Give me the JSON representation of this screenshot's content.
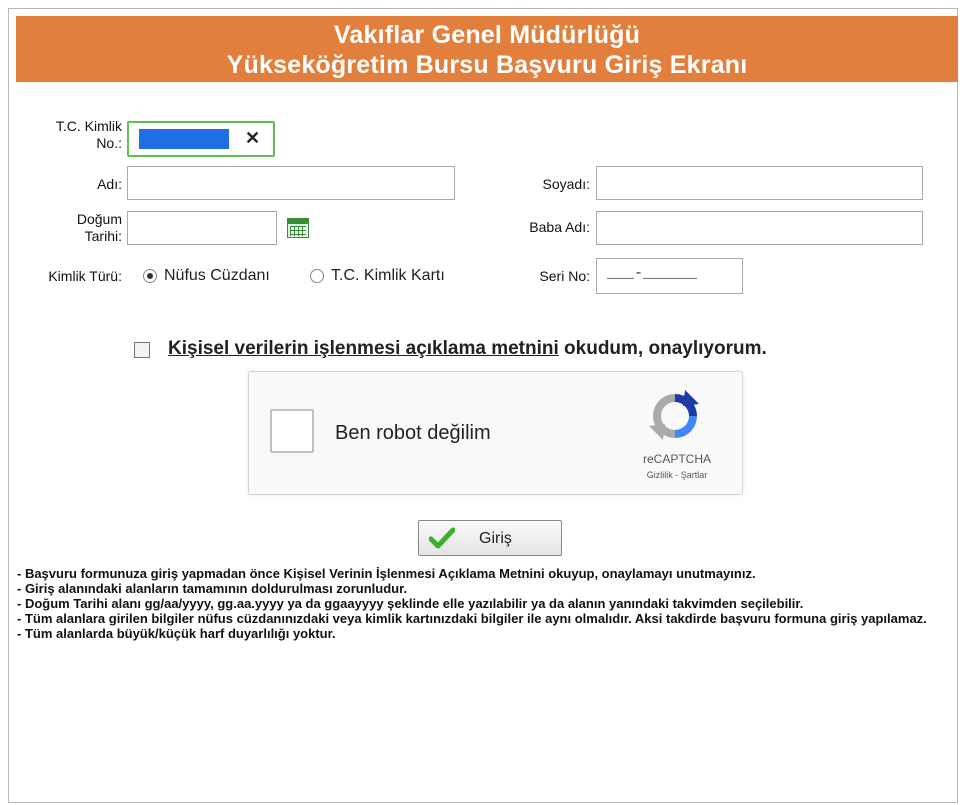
{
  "header": {
    "line1": "Vakıflar Genel Müdürlüğü",
    "line2": "Yükseköğretim Bursu Başvuru Giriş Ekranı"
  },
  "form": {
    "tc_label_1": "T.C. Kimlik",
    "tc_label_2": "No.:",
    "tc_clear": "✕",
    "ad_label": "Adı:",
    "soyad_label": "Soyadı:",
    "dogum_label_1": "Doğum",
    "dogum_label_2": "Tarihi:",
    "baba_label": "Baba Adı:",
    "kimlik_turu_label": "Kimlik Türü:",
    "kimlik_options": [
      "Nüfus Cüzdanı",
      "T.C. Kimlik Kartı"
    ],
    "kimlik_selected": "Nüfus Cüzdanı",
    "seri_label": "Seri No:",
    "seri_value": "___-______"
  },
  "consent": {
    "link_text": "Kişisel verilerin işlenmesi açıklama metnini",
    "rest_text": " okudum, onaylıyorum."
  },
  "captcha": {
    "label": "Ben robot değilim",
    "brand": "reCAPTCHA",
    "links": "Gizlilik - Şartlar"
  },
  "submit": {
    "label": "Giriş"
  },
  "notes": [
    "- Başvuru formunuza giriş yapmadan önce Kişisel Verinin İşlenmesi Açıklama Metnini okuyup, onaylamayı unutmayınız.",
    "- Giriş alanındaki alanların tamamının doldurulması zorunludur.",
    "- Doğum Tarihi alanı gg/aa/yyyy, gg.aa.yyyy ya da ggaayyyy şeklinde elle yazılabilir ya da alanın yanındaki takvimden seçilebilir.",
    "- Tüm alanlara girilen bilgiler nüfus cüzdanınızdaki veya kimlik kartınızdaki bilgiler ile aynı olmalıdır. Aksi takdirde başvuru formuna giriş yapılamaz.",
    "- Tüm alanlarda büyük/küçük harf duyarlılığı yoktur."
  ],
  "colors": {
    "header_bg": "#e27f3d",
    "focus_border": "#5fbf50",
    "selection": "#1f6fe6"
  }
}
